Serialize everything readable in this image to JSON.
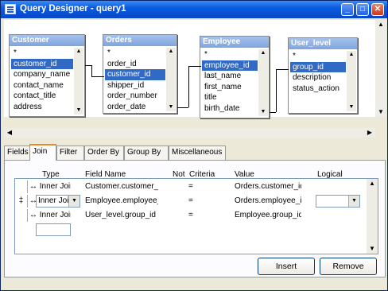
{
  "window": {
    "title": "Query Designer - query1"
  },
  "design_tables": [
    {
      "name": "Customer",
      "fields": [
        "*",
        "customer_id",
        "company_name",
        "contact_name",
        "contact_title",
        "address"
      ],
      "selected_index": 1
    },
    {
      "name": "Orders",
      "fields": [
        "*",
        "order_id",
        "customer_id",
        "shipper_id",
        "order_number",
        "order_date"
      ],
      "selected_index": 2
    },
    {
      "name": "Employee",
      "fields": [
        "*",
        "employee_id",
        "last_name",
        "first_name",
        "title",
        "birth_date"
      ],
      "selected_index": 1
    },
    {
      "name": "User_level",
      "fields": [
        "*",
        "group_id",
        "description",
        "status_action"
      ],
      "selected_index": 1
    }
  ],
  "tabs": [
    "Fields",
    "Join",
    "Filter",
    "Order By",
    "Group By",
    "Miscellaneous"
  ],
  "active_tab": "Join",
  "join_grid": {
    "headers": {
      "type": "Type",
      "field_name": "Field Name",
      "not": "Not",
      "criteria": "Criteria",
      "value": "Value",
      "logical": "Logical"
    },
    "rows": [
      {
        "type": "Inner Join",
        "field_name": "Customer.customer_id",
        "criteria": "=",
        "value": "Orders.customer_id"
      },
      {
        "type": "Inner Join",
        "field_name": "Employee.employee_id",
        "criteria": "=",
        "value": "Orders.employee_id"
      },
      {
        "type": "Inner Join",
        "field_name": "User_level.group_id",
        "criteria": "=",
        "value": "Employee.group_id"
      }
    ],
    "row_marker": "‡"
  },
  "buttons": {
    "insert": "Insert",
    "remove": "Remove"
  }
}
